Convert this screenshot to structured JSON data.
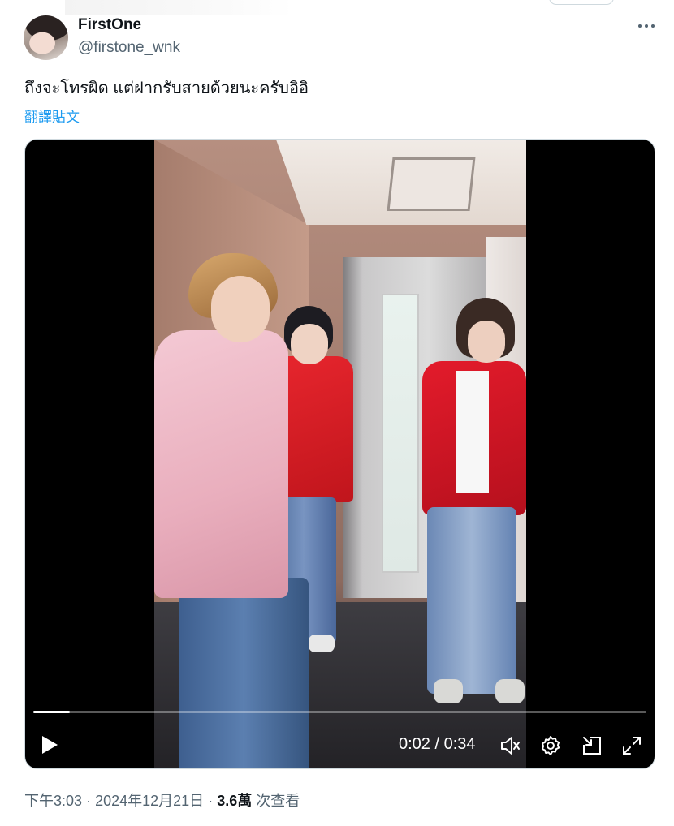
{
  "tweet": {
    "display_name": "FirstOne",
    "handle": "@firstone_wnk",
    "text": "ถึงจะโทรผิด แต่ฝากรับสายด้วยนะครับอิอิ",
    "translate_label": "翻譯貼文"
  },
  "video": {
    "progress_fraction": 0.059,
    "current_time": "0:02",
    "separator": "/",
    "duration": "0:34",
    "icons": [
      "play-icon",
      "volume-icon",
      "settings-icon",
      "minimize-icon",
      "fullscreen-icon"
    ]
  },
  "meta": {
    "time": "下午3:03",
    "dot1": "·",
    "date": "2024年12月21日",
    "dot2": "·",
    "views": "3.6萬",
    "views_label": "次查看"
  }
}
